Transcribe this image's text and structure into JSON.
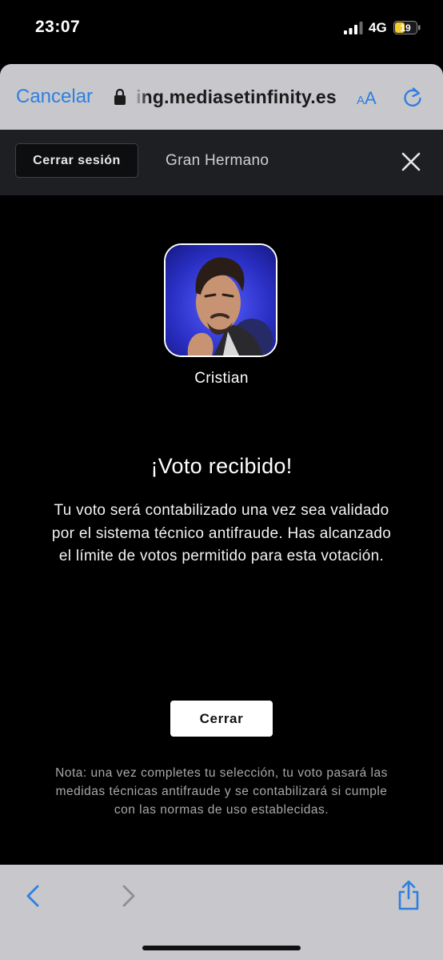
{
  "status_bar": {
    "time": "23:07",
    "network": "4G",
    "battery": "19"
  },
  "safari": {
    "cancel_label": "Cancelar",
    "url": "ing.mediasetinfinity.es",
    "text_size_small": "A",
    "text_size_large": "A"
  },
  "header": {
    "logout_label": "Cerrar sesión",
    "program_title": "Gran Hermano"
  },
  "contestant": {
    "name": "Cristian"
  },
  "vote": {
    "title": "¡Voto recibido!",
    "message": "Tu voto será contabilizado una vez sea validado por el sistema técnico antifraude. Has alcanzado el límite de votos permitido para esta votación.",
    "close_label": "Cerrar",
    "note": "Nota: una vez completes tu selección, tu voto pasará las medidas técnicas antifraude y se contabilizará si cumple con las normas de uso establecidas."
  },
  "colors": {
    "accent": "#2f7fe0",
    "safari_bar": "#c7c7cc",
    "header_bg": "#1d1f22",
    "battery_fill": "#f5cc2b"
  }
}
